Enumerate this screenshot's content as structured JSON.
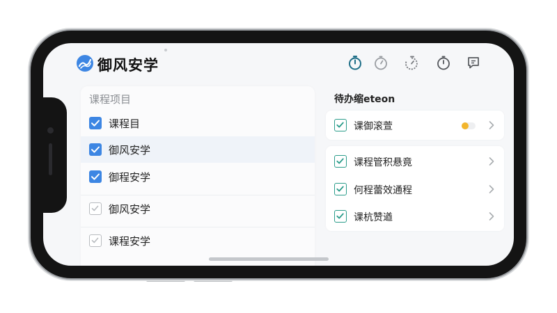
{
  "app": {
    "title": "御风安学",
    "brand_color": "#3d86e3",
    "accent_color": "#2a9c8a"
  },
  "toolbar": {
    "icons": [
      "stopwatch-icon",
      "stopwatch-icon",
      "timer-icon",
      "stopwatch-icon",
      "chat-icon"
    ]
  },
  "left_panel": {
    "header": "课程项目",
    "items": [
      {
        "label": "课程目",
        "checked": true
      },
      {
        "label": "御风安学",
        "checked": true,
        "highlighted": true
      },
      {
        "label": "御程安学",
        "checked": true
      },
      {
        "label": "御风安学",
        "checked": false
      },
      {
        "label": "课程安学",
        "checked": false
      }
    ]
  },
  "right_panel": {
    "title": "待办缩eteon",
    "card1": {
      "label": "课御滚萱",
      "toggle_color": "#f2b52c"
    },
    "card2": {
      "items": [
        {
          "label": "课程管积悬竟"
        },
        {
          "label": "何程蕾效通程"
        },
        {
          "label": "课杭赞遒"
        }
      ]
    }
  }
}
